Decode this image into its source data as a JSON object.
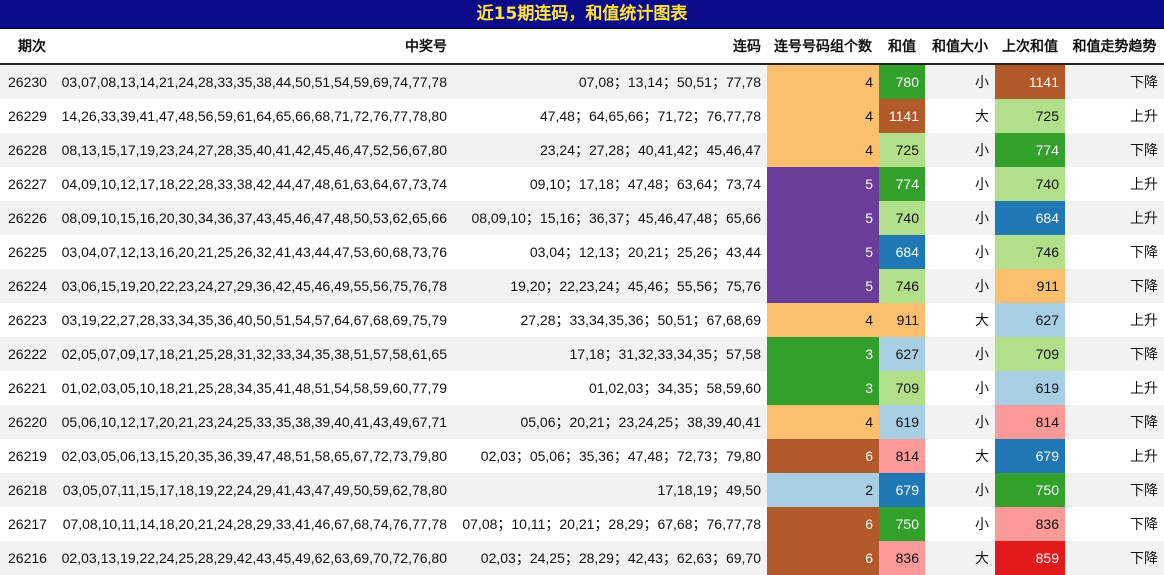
{
  "title": "近15期连码，和值统计图表",
  "headers": {
    "period": "期次",
    "numbers": "中奖号",
    "consecutive": "连码",
    "group_count": "连号号码组个数",
    "sum": "和值",
    "size": "和值大小",
    "prev_sum": "上次和值",
    "trend": "和值走势趋势"
  },
  "count_colors": {
    "2": "#a8cee3",
    "3": "#33a02c",
    "4": "#fcbf6e",
    "5": "#6a3d9a",
    "6": "#b15928"
  },
  "sum_colors": {
    "627": "#a8cee3",
    "619": "#a8cee3",
    "679": "#1f78b4",
    "684": "#1f78b4",
    "709": "#b2df8a",
    "725": "#b2df8a",
    "740": "#b2df8a",
    "746": "#b2df8a",
    "750": "#33a02c",
    "774": "#33a02c",
    "780": "#33a02c",
    "814": "#fb9a99",
    "836": "#fb9a99",
    "859": "#e31a1c",
    "911": "#fcbf6e",
    "1141": "#b15928"
  },
  "rows": [
    {
      "period": "26230",
      "numbers": "03,07,08,13,14,21,24,28,33,35,38,44,50,51,54,59,69,74,77,78",
      "consecutive": "07,08；13,14；50,51；77,78",
      "count": "4",
      "sum": "780",
      "size": "小",
      "prev_sum": "1141",
      "trend": "下降"
    },
    {
      "period": "26229",
      "numbers": "14,26,33,39,41,47,48,56,59,61,64,65,66,68,71,72,76,77,78,80",
      "consecutive": "47,48；64,65,66；71,72；76,77,78",
      "count": "4",
      "sum": "1141",
      "size": "大",
      "prev_sum": "725",
      "trend": "上升"
    },
    {
      "period": "26228",
      "numbers": "08,13,15,17,19,23,24,27,28,35,40,41,42,45,46,47,52,56,67,80",
      "consecutive": "23,24；27,28；40,41,42；45,46,47",
      "count": "4",
      "sum": "725",
      "size": "小",
      "prev_sum": "774",
      "trend": "下降"
    },
    {
      "period": "26227",
      "numbers": "04,09,10,12,17,18,22,28,33,38,42,44,47,48,61,63,64,67,73,74",
      "consecutive": "09,10；17,18；47,48；63,64；73,74",
      "count": "5",
      "sum": "774",
      "size": "小",
      "prev_sum": "740",
      "trend": "上升"
    },
    {
      "period": "26226",
      "numbers": "08,09,10,15,16,20,30,34,36,37,43,45,46,47,48,50,53,62,65,66",
      "consecutive": "08,09,10；15,16；36,37；45,46,47,48；65,66",
      "count": "5",
      "sum": "740",
      "size": "小",
      "prev_sum": "684",
      "trend": "上升"
    },
    {
      "period": "26225",
      "numbers": "03,04,07,12,13,16,20,21,25,26,32,41,43,44,47,53,60,68,73,76",
      "consecutive": "03,04；12,13；20,21；25,26；43,44",
      "count": "5",
      "sum": "684",
      "size": "小",
      "prev_sum": "746",
      "trend": "下降"
    },
    {
      "period": "26224",
      "numbers": "03,06,15,19,20,22,23,24,27,29,36,42,45,46,49,55,56,75,76,78",
      "consecutive": "19,20；22,23,24；45,46；55,56；75,76",
      "count": "5",
      "sum": "746",
      "size": "小",
      "prev_sum": "911",
      "trend": "下降"
    },
    {
      "period": "26223",
      "numbers": "03,19,22,27,28,33,34,35,36,40,50,51,54,57,64,67,68,69,75,79",
      "consecutive": "27,28；33,34,35,36；50,51；67,68,69",
      "count": "4",
      "sum": "911",
      "size": "大",
      "prev_sum": "627",
      "trend": "上升"
    },
    {
      "period": "26222",
      "numbers": "02,05,07,09,17,18,21,25,28,31,32,33,34,35,38,51,57,58,61,65",
      "consecutive": "17,18；31,32,33,34,35；57,58",
      "count": "3",
      "sum": "627",
      "size": "小",
      "prev_sum": "709",
      "trend": "下降"
    },
    {
      "period": "26221",
      "numbers": "01,02,03,05,10,18,21,25,28,34,35,41,48,51,54,58,59,60,77,79",
      "consecutive": "01,02,03；34,35；58,59,60",
      "count": "3",
      "sum": "709",
      "size": "小",
      "prev_sum": "619",
      "trend": "上升"
    },
    {
      "period": "26220",
      "numbers": "05,06,10,12,17,20,21,23,24,25,33,35,38,39,40,41,43,49,67,71",
      "consecutive": "05,06；20,21；23,24,25；38,39,40,41",
      "count": "4",
      "sum": "619",
      "size": "小",
      "prev_sum": "814",
      "trend": "下降"
    },
    {
      "period": "26219",
      "numbers": "02,03,05,06,13,15,20,35,36,39,47,48,51,58,65,67,72,73,79,80",
      "consecutive": "02,03；05,06；35,36；47,48；72,73；79,80",
      "count": "6",
      "sum": "814",
      "size": "大",
      "prev_sum": "679",
      "trend": "上升"
    },
    {
      "period": "26218",
      "numbers": "03,05,07,11,15,17,18,19,22,24,29,41,43,47,49,50,59,62,78,80",
      "consecutive": "17,18,19；49,50",
      "count": "2",
      "sum": "679",
      "size": "小",
      "prev_sum": "750",
      "trend": "下降"
    },
    {
      "period": "26217",
      "numbers": "07,08,10,11,14,18,20,21,24,28,29,33,41,46,67,68,74,76,77,78",
      "consecutive": "07,08；10,11；20,21；28,29；67,68；76,77,78",
      "count": "6",
      "sum": "750",
      "size": "小",
      "prev_sum": "836",
      "trend": "下降"
    },
    {
      "period": "26216",
      "numbers": "02,03,13,19,22,24,25,28,29,42,43,45,49,62,63,69,70,72,76,80",
      "consecutive": "02,03；24,25；28,29；42,43；62,63；69,70",
      "count": "6",
      "sum": "836",
      "size": "大",
      "prev_sum": "859",
      "trend": "下降"
    }
  ]
}
